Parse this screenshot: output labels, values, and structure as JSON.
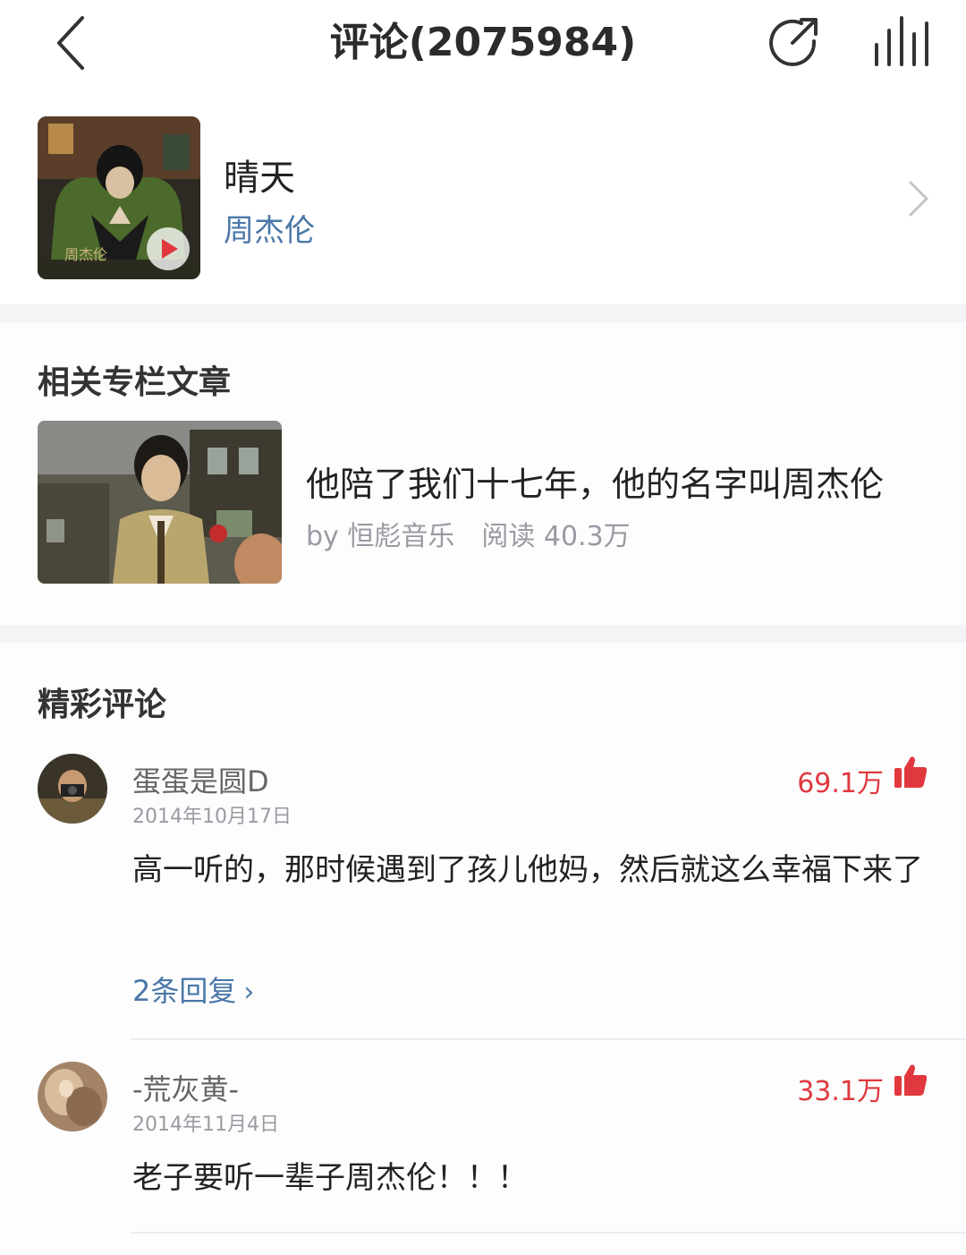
{
  "header": {
    "title": "评论(2075984)",
    "back_icon": "back-arrow-icon",
    "share_icon": "share-icon",
    "chart_icon": "audio-bars-icon"
  },
  "song": {
    "title": "晴天",
    "artist": "周杰伦"
  },
  "column": {
    "section_title": "相关专栏文章",
    "article": {
      "title": "他陪了我们十七年，他的名字叫周杰伦",
      "author": "by 恒彪音乐",
      "reads": "阅读 40.3万"
    }
  },
  "comments": {
    "section_title": "精彩评论",
    "items": [
      {
        "username": "蛋蛋是圆D",
        "date": "2014年10月17日",
        "likes": "69.1万",
        "text": "高一听的，那时候遇到了孩儿他妈，然后就这么幸福下来了",
        "replies": "2条回复"
      },
      {
        "username": "-荒灰黄-",
        "date": "2014年11月4日",
        "likes": "33.1万",
        "text": "老子要听一辈子周杰伦！！！"
      }
    ]
  },
  "colors": {
    "accent_red": "#e0383e",
    "link_blue": "#4a77a8",
    "muted_gray": "#9a9aa3"
  }
}
